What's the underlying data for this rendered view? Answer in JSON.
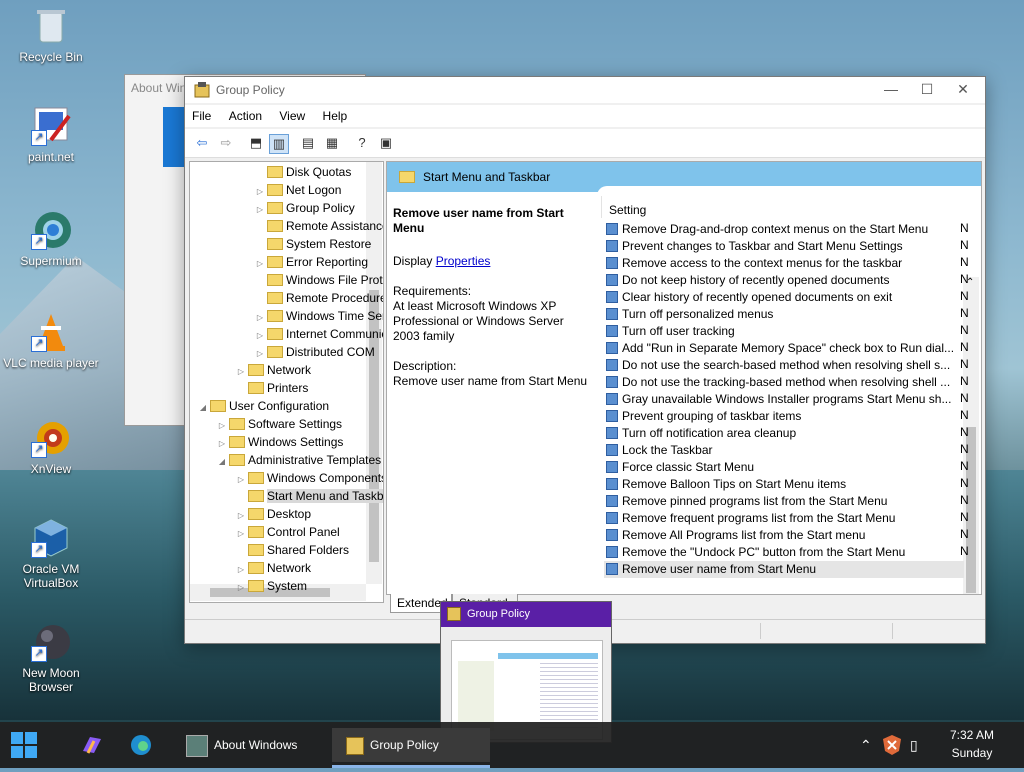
{
  "desktop": {
    "icons": [
      {
        "label": "Recycle Bin"
      },
      {
        "label": "paint.net"
      },
      {
        "label": "Supermium"
      },
      {
        "label": "VLC media player"
      },
      {
        "label": "XnView"
      },
      {
        "label": "Oracle VM VirtualBox"
      },
      {
        "label": "New Moon Browser"
      }
    ]
  },
  "about_window": {
    "title": "About Windows"
  },
  "window": {
    "title": "Group Policy",
    "menu": [
      "File",
      "Action",
      "View",
      "Help"
    ],
    "tree": [
      {
        "label": "Disk Quotas",
        "indent": 3,
        "tw": ""
      },
      {
        "label": "Net Logon",
        "indent": 3,
        "tw": "▷"
      },
      {
        "label": "Group Policy",
        "indent": 3,
        "tw": "▷"
      },
      {
        "label": "Remote Assistance",
        "indent": 3,
        "tw": ""
      },
      {
        "label": "System Restore",
        "indent": 3,
        "tw": ""
      },
      {
        "label": "Error Reporting",
        "indent": 3,
        "tw": "▷"
      },
      {
        "label": "Windows File Protection",
        "indent": 3,
        "tw": ""
      },
      {
        "label": "Remote Procedure Call",
        "indent": 3,
        "tw": ""
      },
      {
        "label": "Windows Time Service",
        "indent": 3,
        "tw": "▷"
      },
      {
        "label": "Internet Communication",
        "indent": 3,
        "tw": "▷"
      },
      {
        "label": "Distributed COM",
        "indent": 3,
        "tw": "▷"
      },
      {
        "label": "Network",
        "indent": 2,
        "tw": "▷"
      },
      {
        "label": "Printers",
        "indent": 2,
        "tw": ""
      },
      {
        "label": "User Configuration",
        "indent": 0,
        "tw": "◢"
      },
      {
        "label": "Software Settings",
        "indent": 1,
        "tw": "▷"
      },
      {
        "label": "Windows Settings",
        "indent": 1,
        "tw": "▷"
      },
      {
        "label": "Administrative Templates",
        "indent": 1,
        "tw": "◢"
      },
      {
        "label": "Windows Components",
        "indent": 2,
        "tw": "▷"
      },
      {
        "label": "Start Menu and Taskbar",
        "indent": 2,
        "tw": "",
        "selected": true
      },
      {
        "label": "Desktop",
        "indent": 2,
        "tw": "▷"
      },
      {
        "label": "Control Panel",
        "indent": 2,
        "tw": "▷"
      },
      {
        "label": "Shared Folders",
        "indent": 2,
        "tw": ""
      },
      {
        "label": "Network",
        "indent": 2,
        "tw": "▷"
      },
      {
        "label": "System",
        "indent": 2,
        "tw": "▷"
      }
    ],
    "right_header": "Start Menu and Taskbar",
    "description": {
      "title": "Remove user name from Start Menu",
      "display_prefix": "Display ",
      "display_link": "Properties",
      "requirements_label": "Requirements:",
      "requirements": "At least Microsoft Windows XP Professional or Windows Server 2003 family",
      "description_label": "Description:",
      "description": "Remove user name from Start Menu"
    },
    "settings_header": "Setting",
    "settings": [
      "Remove Drag-and-drop context menus on the Start Menu",
      "Prevent changes to Taskbar and Start Menu Settings",
      "Remove access to the context menus for the taskbar",
      "Do not keep history of recently opened documents",
      "Clear history of recently opened documents on exit",
      "Turn off personalized menus",
      "Turn off user tracking",
      "Add \"Run in Separate Memory Space\" check box to Run dial...",
      "Do not use the search-based method when resolving shell s...",
      "Do not use the tracking-based method when resolving shell ...",
      "Gray unavailable Windows Installer programs Start Menu sh...",
      "Prevent grouping of taskbar items",
      "Turn off notification area cleanup",
      "Lock the Taskbar",
      "Force classic Start Menu",
      "Remove Balloon Tips on Start Menu items",
      "Remove pinned programs list from the Start Menu",
      "Remove frequent programs list from the Start Menu",
      "Remove All Programs list from the Start menu",
      "Remove the \"Undock PC\" button from the Start Menu",
      "Remove user name from Start Menu"
    ],
    "settings_state_char": "N",
    "tabs": [
      "Extended",
      "Standard"
    ]
  },
  "preview": {
    "title": "Group Policy"
  },
  "taskbar": {
    "about": "About Windows",
    "gp": "Group Policy",
    "time": "7:32 AM",
    "day": "Sunday"
  }
}
